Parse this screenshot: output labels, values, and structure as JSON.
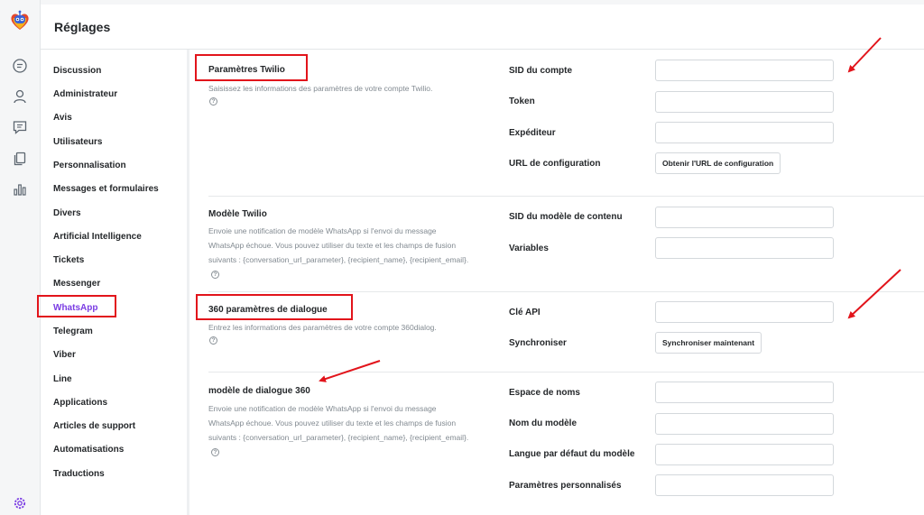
{
  "header": {
    "title": "Réglages"
  },
  "rail": {
    "icons": [
      "app-logo-icon",
      "chat-icon",
      "user-icon",
      "message-square-icon",
      "documents-icon",
      "bar-chart-icon",
      "gear-icon"
    ]
  },
  "nav": {
    "items": [
      {
        "label": "Discussion"
      },
      {
        "label": "Administrateur"
      },
      {
        "label": "Avis"
      },
      {
        "label": "Utilisateurs"
      },
      {
        "label": "Personnalisation"
      },
      {
        "label": "Messages et formulaires"
      },
      {
        "label": "Divers"
      },
      {
        "label": "Artificial Intelligence"
      },
      {
        "label": "Tickets"
      },
      {
        "label": "Messenger"
      },
      {
        "label": "WhatsApp",
        "active": true
      },
      {
        "label": "Telegram"
      },
      {
        "label": "Viber"
      },
      {
        "label": "Line"
      },
      {
        "label": "Applications"
      },
      {
        "label": "Articles de support"
      },
      {
        "label": "Automatisations"
      },
      {
        "label": "Traductions"
      }
    ]
  },
  "sections": {
    "twilio": {
      "title": "Paramètres Twilio",
      "desc": "Saisissez les informations des paramètres de votre compte Twilio.",
      "fields": {
        "account_sid": "SID du compte",
        "token": "Token",
        "sender": "Expéditeur",
        "config_url": "URL de configuration"
      },
      "config_url_button": "Obtenir l'URL de configuration"
    },
    "twilio_template": {
      "title": "Modèle Twilio",
      "desc": "Envoie une notification de modèle WhatsApp si l'envoi du message WhatsApp échoue. Vous pouvez utiliser du texte et les champs de fusion suivants : {conversation_url_parameter}, {recipient_name}, {recipient_email}.",
      "fields": {
        "content_sid": "SID du modèle de contenu",
        "variables": "Variables"
      }
    },
    "dialog360": {
      "title": "360 paramètres de dialogue",
      "desc": "Entrez les informations des paramètres de votre compte 360dialog.",
      "fields": {
        "api_key": "Clé API",
        "sync": "Synchroniser"
      },
      "sync_button": "Synchroniser maintenant"
    },
    "dialog360_template": {
      "title": "modèle de dialogue 360",
      "desc": "Envoie une notification de modèle WhatsApp si l'envoi du message WhatsApp échoue. Vous pouvez utiliser du texte et les champs de fusion suivants : {conversation_url_parameter}, {recipient_name}, {recipient_email}.",
      "fields": {
        "namespace": "Espace de noms",
        "template_name": "Nom du modèle",
        "default_language": "Langue par défaut du modèle",
        "custom_params": "Paramètres personnalisés"
      }
    }
  },
  "help_glyph": "?",
  "colors": {
    "accent": "#7a3ce3",
    "highlight": "#e2141b",
    "text": "#24272a",
    "muted": "#828a91"
  }
}
